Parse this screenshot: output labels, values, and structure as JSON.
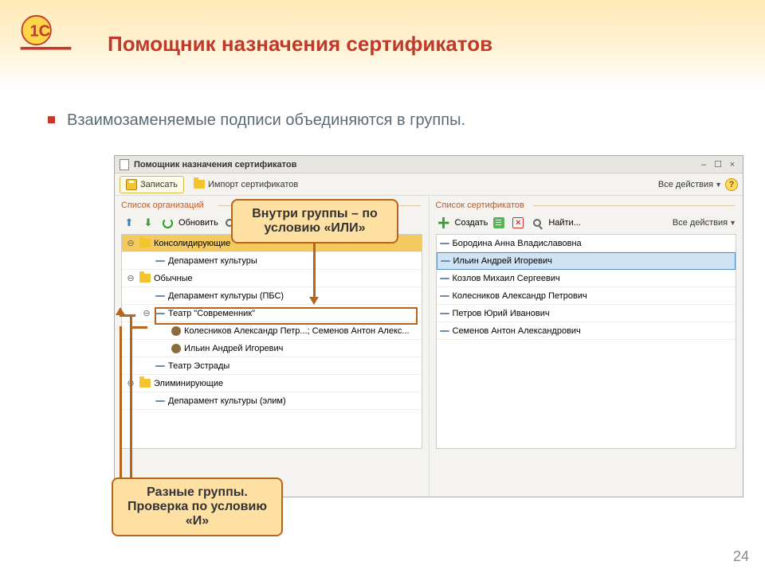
{
  "slide": {
    "title": "Помощник назначения сертификатов",
    "body": "Взаимозаменяемые подписи объединяются в группы.",
    "page": "24"
  },
  "window": {
    "title": "Помощник назначения сертификатов",
    "save": "Записать",
    "import": "Импорт сертификатов",
    "all_actions": "Все действия"
  },
  "left_panel": {
    "label": "Список организаций",
    "refresh": "Обновить",
    "find": "Найти...",
    "tree": [
      {
        "expander": "⊖",
        "type": "folder",
        "label": "Консолидирующие",
        "selected": true,
        "indent": 0
      },
      {
        "type": "dash",
        "label": "Депарамент культуры",
        "indent": 1
      },
      {
        "expander": "⊖",
        "type": "folder",
        "label": "Обычные",
        "indent": 0
      },
      {
        "type": "dash",
        "label": "Депарамент культуры (ПБС)",
        "indent": 1
      },
      {
        "expander": "⊖",
        "type": "dash",
        "label": "Театр \"Современник\"",
        "indent": 1
      },
      {
        "type": "person",
        "label": "Колесников Александр Петр...; Семенов Антон Алекс...",
        "indent": 2
      },
      {
        "type": "person",
        "label": "Ильин Андрей Игоревич",
        "indent": 2
      },
      {
        "type": "dash",
        "label": "Театр Эстрады",
        "indent": 1
      },
      {
        "expander": "⊖",
        "type": "folder",
        "label": "Элиминирующие",
        "indent": 0
      },
      {
        "type": "dash",
        "label": "Депарамент культуры (элим)",
        "indent": 1
      }
    ]
  },
  "right_panel": {
    "label": "Список сертификатов",
    "create": "Создать",
    "find": "Найти...",
    "list": [
      {
        "label": "Бородина Анна Владиславовна"
      },
      {
        "label": "Ильин Андрей Игоревич",
        "selected": true
      },
      {
        "label": "Козлов Михаил Сергеевич"
      },
      {
        "label": "Колесников Александр Петрович"
      },
      {
        "label": "Петров Юрий Иванович"
      },
      {
        "label": "Семенов Антон Александрович"
      }
    ]
  },
  "callouts": {
    "c1": "Внутри группы – по условию «ИЛИ»",
    "c2": "Разные группы. Проверка по условию «И»"
  }
}
